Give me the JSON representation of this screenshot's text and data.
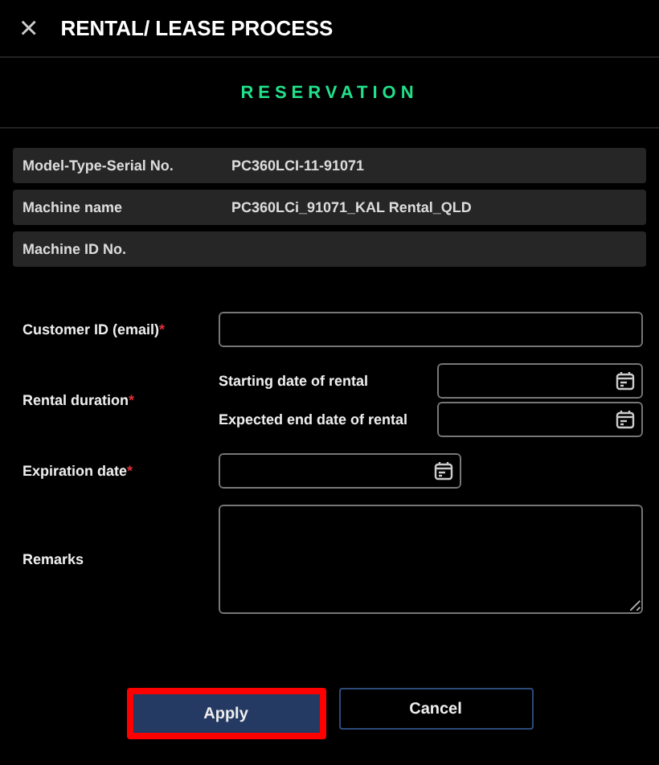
{
  "window": {
    "title": "RENTAL/ LEASE PROCESS",
    "close_icon": "×"
  },
  "section_title": "RESERVATION",
  "info_rows": [
    {
      "label": "Model-Type-Serial No.",
      "value": "PC360LCI-11-91071"
    },
    {
      "label": "Machine name",
      "value": "PC360LCi_91071_KAL Rental_QLD"
    },
    {
      "label": "Machine ID No."
    }
  ],
  "form": [
    {
      "kind": "text",
      "label": "Customer ID (email)",
      "required_mark": "*"
    },
    {
      "kind": "range",
      "label": "Rental duration",
      "required_mark": "*",
      "subfields": [
        {
          "label": "Starting date of rental"
        },
        {
          "label": "Expected end date of rental"
        }
      ]
    },
    {
      "kind": "date",
      "label": "Expiration date",
      "required_mark": "*"
    },
    {
      "kind": "textarea",
      "label": "Remarks"
    }
  ],
  "buttons": [
    {
      "label": "Apply",
      "kind": "primary",
      "highlighted": true
    },
    {
      "label": "Cancel",
      "kind": "secondary",
      "highlighted": false
    }
  ]
}
